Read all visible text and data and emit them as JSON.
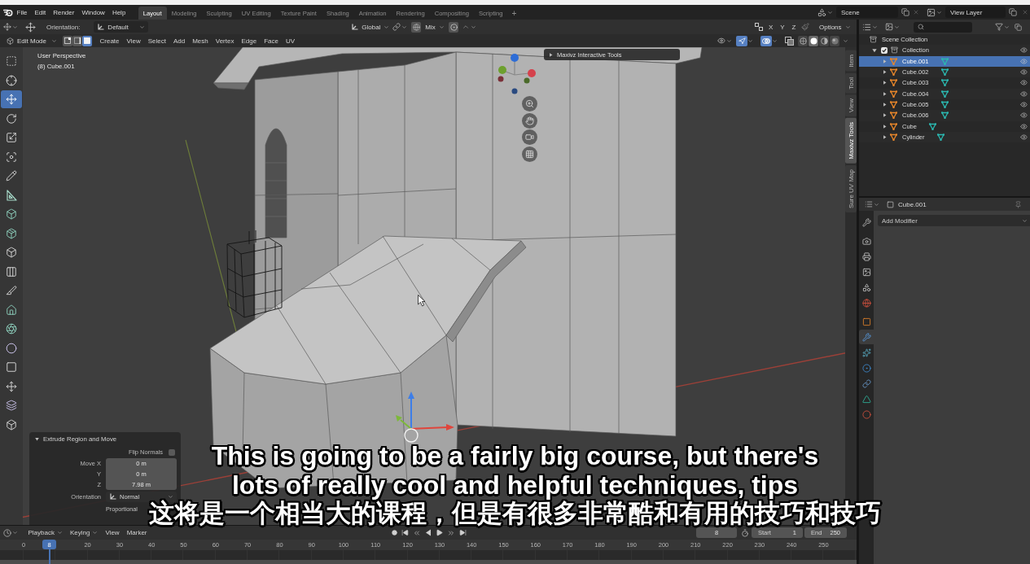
{
  "top_bar": {
    "menus": [
      "File",
      "Edit",
      "Render",
      "Window",
      "Help"
    ],
    "workspaces": [
      {
        "label": "Layout",
        "selected": true
      },
      {
        "label": "Modeling",
        "selected": false
      },
      {
        "label": "Sculpting",
        "selected": false
      },
      {
        "label": "UV Editing",
        "selected": false
      },
      {
        "label": "Texture Paint",
        "selected": false
      },
      {
        "label": "Shading",
        "selected": false
      },
      {
        "label": "Animation",
        "selected": false
      },
      {
        "label": "Rendering",
        "selected": false
      },
      {
        "label": "Compositing",
        "selected": false
      },
      {
        "label": "Scripting",
        "selected": false
      }
    ],
    "add_workspace": "+",
    "scene": "Scene",
    "view_layer": "View Layer"
  },
  "tool_settings": {
    "orientation_label": "Orientation:",
    "orientation": "Default",
    "transform_orientation": "Global",
    "mix_dropdown": "Mix",
    "axes": [
      "X",
      "Y",
      "Z"
    ],
    "options": "Options"
  },
  "viewport_header": {
    "mode": "Edit Mode",
    "select_modes": [
      {
        "kind": "vertex",
        "selected": false
      },
      {
        "kind": "edge",
        "selected": false
      },
      {
        "kind": "face",
        "selected": true
      }
    ],
    "menus": [
      "Create",
      "View",
      "Select",
      "Add",
      "Mesh",
      "Vertex",
      "Edge",
      "Face",
      "UV"
    ],
    "gizmos_on": true,
    "overlays_on": true,
    "shading_modes": [
      {
        "kind": "wireframe",
        "selected": false
      },
      {
        "kind": "solid",
        "selected": true
      },
      {
        "kind": "material",
        "selected": false
      },
      {
        "kind": "rendered",
        "selected": false
      }
    ]
  },
  "toolbar": {
    "tools": [
      {
        "kind": "select_box",
        "selected": false
      },
      {
        "kind": "cursor",
        "selected": false
      },
      {
        "kind": "move",
        "selected": true
      },
      {
        "kind": "rotate",
        "selected": false
      },
      {
        "kind": "scale",
        "selected": false
      },
      {
        "kind": "transform",
        "selected": false
      },
      {
        "kind": "annotate",
        "selected": false
      },
      {
        "kind": "measure",
        "selected": false
      },
      {
        "kind": "extrude",
        "selected": false
      },
      {
        "kind": "inset",
        "selected": false
      },
      {
        "kind": "bevel",
        "selected": false
      },
      {
        "kind": "loop_cut",
        "selected": false
      },
      {
        "kind": "knife",
        "selected": false
      },
      {
        "kind": "poly_build",
        "selected": false
      },
      {
        "kind": "spin",
        "selected": false
      },
      {
        "kind": "smooth",
        "selected": false
      },
      {
        "kind": "edge_slide",
        "selected": false
      },
      {
        "kind": "shrink_fatten",
        "selected": false
      },
      {
        "kind": "shear",
        "selected": false
      },
      {
        "kind": "rip",
        "selected": false
      }
    ]
  },
  "viewport": {
    "view_name": "User Perspective",
    "object_info": "(8) Cube.001",
    "addon_panel": {
      "title": "Maxivz Interactive Tools",
      "expanded": false
    },
    "sidebar_tabs": [
      {
        "label": "Item",
        "selected": false
      },
      {
        "label": "Tool",
        "selected": false
      },
      {
        "label": "View",
        "selected": false
      },
      {
        "label": "Maxivz Tools",
        "selected": true
      },
      {
        "label": "Sure UV Map",
        "selected": false
      }
    ]
  },
  "operator_panel": {
    "title": "Extrude Region and Move",
    "expanded": true,
    "flip_normals": {
      "label": "Flip Normals",
      "checked": false
    },
    "move_fields": [
      {
        "label": "Move X",
        "value": "0 m"
      },
      {
        "label": "Y",
        "value": "0 m"
      },
      {
        "label": "Z",
        "value": "7.98 m"
      }
    ],
    "orientation": {
      "label": "Orientation",
      "value": "Normal"
    },
    "proportional": "Proportional"
  },
  "outliner": {
    "root": "Scene Collection",
    "collections": [
      {
        "label": "Collection",
        "checked": true,
        "expanded": true,
        "children": [
          {
            "label": "Cube.001",
            "selected": true,
            "expanded": false
          },
          {
            "label": "Cube.002",
            "selected": false,
            "expanded": false
          },
          {
            "label": "Cube.003",
            "selected": false,
            "expanded": false
          },
          {
            "label": "Cube.004",
            "selected": false,
            "expanded": false
          },
          {
            "label": "Cube.005",
            "selected": false,
            "expanded": false
          },
          {
            "label": "Cube.006",
            "selected": false,
            "expanded": false
          },
          {
            "label": "Cube",
            "selected": false,
            "expanded": false
          },
          {
            "label": "Cylinder",
            "selected": false,
            "expanded": false
          }
        ]
      }
    ]
  },
  "properties": {
    "object": "Cube.001",
    "tabs": [
      {
        "kind": "tool",
        "selected": false
      },
      {
        "kind": "render",
        "selected": false
      },
      {
        "kind": "output",
        "selected": false
      },
      {
        "kind": "view_layer",
        "selected": false
      },
      {
        "kind": "scene",
        "selected": false
      },
      {
        "kind": "world",
        "selected": false
      },
      {
        "kind": "object",
        "selected": false
      },
      {
        "kind": "modifiers",
        "selected": true
      },
      {
        "kind": "particles",
        "selected": false
      },
      {
        "kind": "physics",
        "selected": false
      },
      {
        "kind": "constraints",
        "selected": false
      },
      {
        "kind": "data",
        "selected": false
      },
      {
        "kind": "material",
        "selected": false
      }
    ],
    "add_modifier": "Add Modifier"
  },
  "timeline": {
    "menus": [
      {
        "label": "Playback",
        "kind": "dropdown"
      },
      {
        "label": "Keying",
        "kind": "dropdown"
      },
      {
        "label": "View",
        "kind": "menu"
      },
      {
        "label": "Marker",
        "kind": "menu"
      }
    ],
    "current_frame": "8",
    "start_label": "Start",
    "start": "1",
    "end_label": "End",
    "end": "250",
    "frame_numbers": [
      "0",
      "20",
      "30",
      "40",
      "50",
      "60",
      "70",
      "80",
      "90",
      "100",
      "110",
      "120",
      "130",
      "140",
      "150",
      "160",
      "170",
      "180",
      "190",
      "200",
      "210",
      "220",
      "230",
      "240",
      "250"
    ],
    "playhead": "8"
  },
  "subtitles": [
    {
      "kind": "latin",
      "text": "This is going to be a fairly big course, but there's"
    },
    {
      "kind": "latin",
      "text": "lots of really cool and helpful techniques, tips"
    },
    {
      "kind": "cjk",
      "text": "这将是一个相当大的课程，但是有很多非常酷和有用的技巧和技巧"
    }
  ]
}
